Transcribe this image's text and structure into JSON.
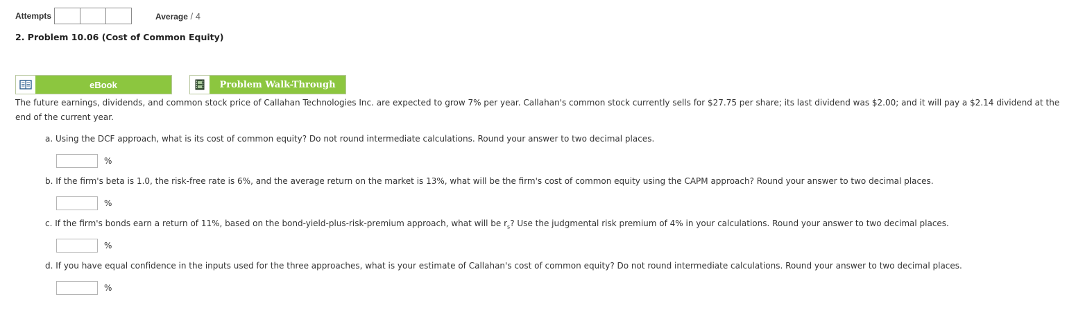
{
  "header": {
    "attempts_label": "Attempts",
    "attempt_boxes": 3,
    "average_label": "Average",
    "average_sep": " / ",
    "average_value": "4"
  },
  "problem": {
    "title": "2.  Problem 10.06 (Cost of Common Equity)"
  },
  "tools": {
    "ebook_label": "eBook",
    "ebook_icon": "book-icon",
    "walkthrough_label": "Problem Walk-Through",
    "walkthrough_icon": "film-icon",
    "accent_color": "#8cc63f"
  },
  "intro": "The future earnings, dividends, and common stock price of Callahan Technologies Inc. are expected to grow 7% per year. Callahan's common stock currently sells for $27.75 per share; its last dividend was $2.00; and it will pay a $2.14 dividend at the end of the current year.",
  "questions": [
    {
      "text": "a. Using the DCF approach, what is its cost of common equity? Do not round intermediate calculations. Round your answer to two decimal places.",
      "value": "",
      "unit": "%"
    },
    {
      "text": "b. If the firm's beta is 1.0, the risk-free rate is 6%, and the average return on the market is 13%, what will be the firm's cost of common equity using the CAPM approach? Round your answer to two decimal places.",
      "value": "",
      "unit": "%"
    },
    {
      "text_pre": "c. If the firm's bonds earn a return of 11%, based on the bond-yield-plus-risk-premium approach, what will be r",
      "text_sub": "s",
      "text_post": "? Use the judgmental risk premium of 4% in your calculations. Round your answer to two decimal places.",
      "value": "",
      "unit": "%"
    },
    {
      "text": "d. If you have equal confidence in the inputs used for the three approaches, what is your estimate of Callahan's cost of common equity? Do not round intermediate calculations. Round your answer to two decimal places.",
      "value": "",
      "unit": "%"
    }
  ]
}
